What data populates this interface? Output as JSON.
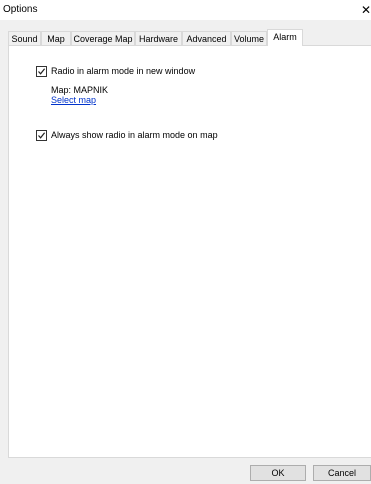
{
  "window": {
    "title": "Options",
    "close_glyph": "✕"
  },
  "tabs": [
    {
      "label": "Sound"
    },
    {
      "label": "Map"
    },
    {
      "label": "Coverage Map"
    },
    {
      "label": "Hardware"
    },
    {
      "label": "Advanced"
    },
    {
      "label": "Volume"
    },
    {
      "label": "Alarm"
    }
  ],
  "active_tab": "Alarm",
  "alarm": {
    "new_window_checkbox": {
      "label": "Radio in alarm mode in new window",
      "checked": true
    },
    "map_line": "Map: MAPNIK",
    "select_map_link": "Select map",
    "show_on_map_checkbox": {
      "label": "Always show radio in alarm mode on map",
      "checked": true
    }
  },
  "buttons": {
    "ok": "OK",
    "cancel": "Cancel"
  },
  "colors": {
    "link": "#0033cc",
    "panel": "#ffffff",
    "background": "#f0f0f0"
  }
}
